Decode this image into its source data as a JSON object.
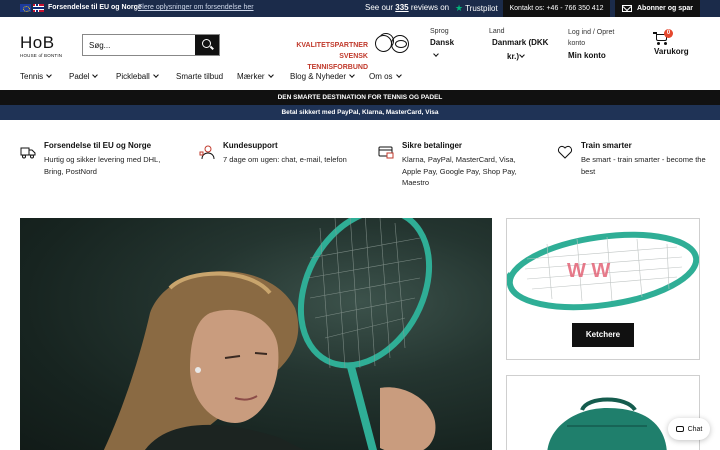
{
  "topbar": {
    "shipping": "Forsendelse til EU og Norge",
    "shipping_link": "Flere oplysninger om forsendelse her",
    "reviews_prefix": "See our",
    "reviews_count": "335",
    "reviews_suffix": "reviews on",
    "trustpilot": "Trustpilot",
    "contact": "Kontakt os: +46 - 766 350 412",
    "subscribe": "Abonner og spar"
  },
  "header": {
    "logo": "HoB",
    "logo_sub": "HOUSE of BONTIN",
    "search_placeholder": "Søg...",
    "partner_line1": "KVALITETSPARTNER SVENSK",
    "partner_line2": "TENNISFORBUND",
    "language_label": "Sprog",
    "language_value": "Dansk",
    "country_label": "Land",
    "country_value_line1": "Danmark (DKK",
    "country_value_line2": "kr.)",
    "account_label_line1": "Log ind / Opret",
    "account_label_line2": "konto",
    "account_value": "Min konto",
    "cart_count": "0",
    "cart_label": "Varukorg"
  },
  "nav": {
    "items": [
      {
        "label": "Tennis",
        "dropdown": true
      },
      {
        "label": "Padel",
        "dropdown": true
      },
      {
        "label": "Pickleball",
        "dropdown": true
      },
      {
        "label": "Smarte tilbud",
        "dropdown": false
      },
      {
        "label": "Mærker",
        "dropdown": true
      },
      {
        "label": "Blog & Nyheder",
        "dropdown": true
      },
      {
        "label": "Om os",
        "dropdown": true
      }
    ]
  },
  "banners": {
    "primary": "DEN SMARTE DESTINATION FOR TENNIS OG PADEL",
    "secondary": "Betal sikkert med PayPal, Klarna, MasterCard, Visa"
  },
  "usps": [
    {
      "icon": "delivery-truck-icon",
      "title": "Forsendelse til EU og Norge",
      "text": "Hurtig og sikker levering med DHL, Bring, PostNord"
    },
    {
      "icon": "support-agent-icon",
      "title": "Kundesupport",
      "text": "7 dage om ugen: chat, e-mail, telefon"
    },
    {
      "icon": "secure-payment-icon",
      "title": "Sikre betalinger",
      "text": "Klarna, PayPal, MasterCard, Visa, Apple Pay, Google Pay, Shop Pay, Maestro"
    },
    {
      "icon": "heart-icon",
      "title": "Train smarter",
      "text": "Be smart - train smarter - become the best"
    }
  ],
  "tiles": {
    "rackets_button": "Ketchere"
  },
  "chat": {
    "label": "Chat"
  },
  "colors": {
    "topbar": "#1b2b4a",
    "accent_red": "#c0392b",
    "racket_green": "#2fae96",
    "cart_badge": "#e5482e"
  }
}
